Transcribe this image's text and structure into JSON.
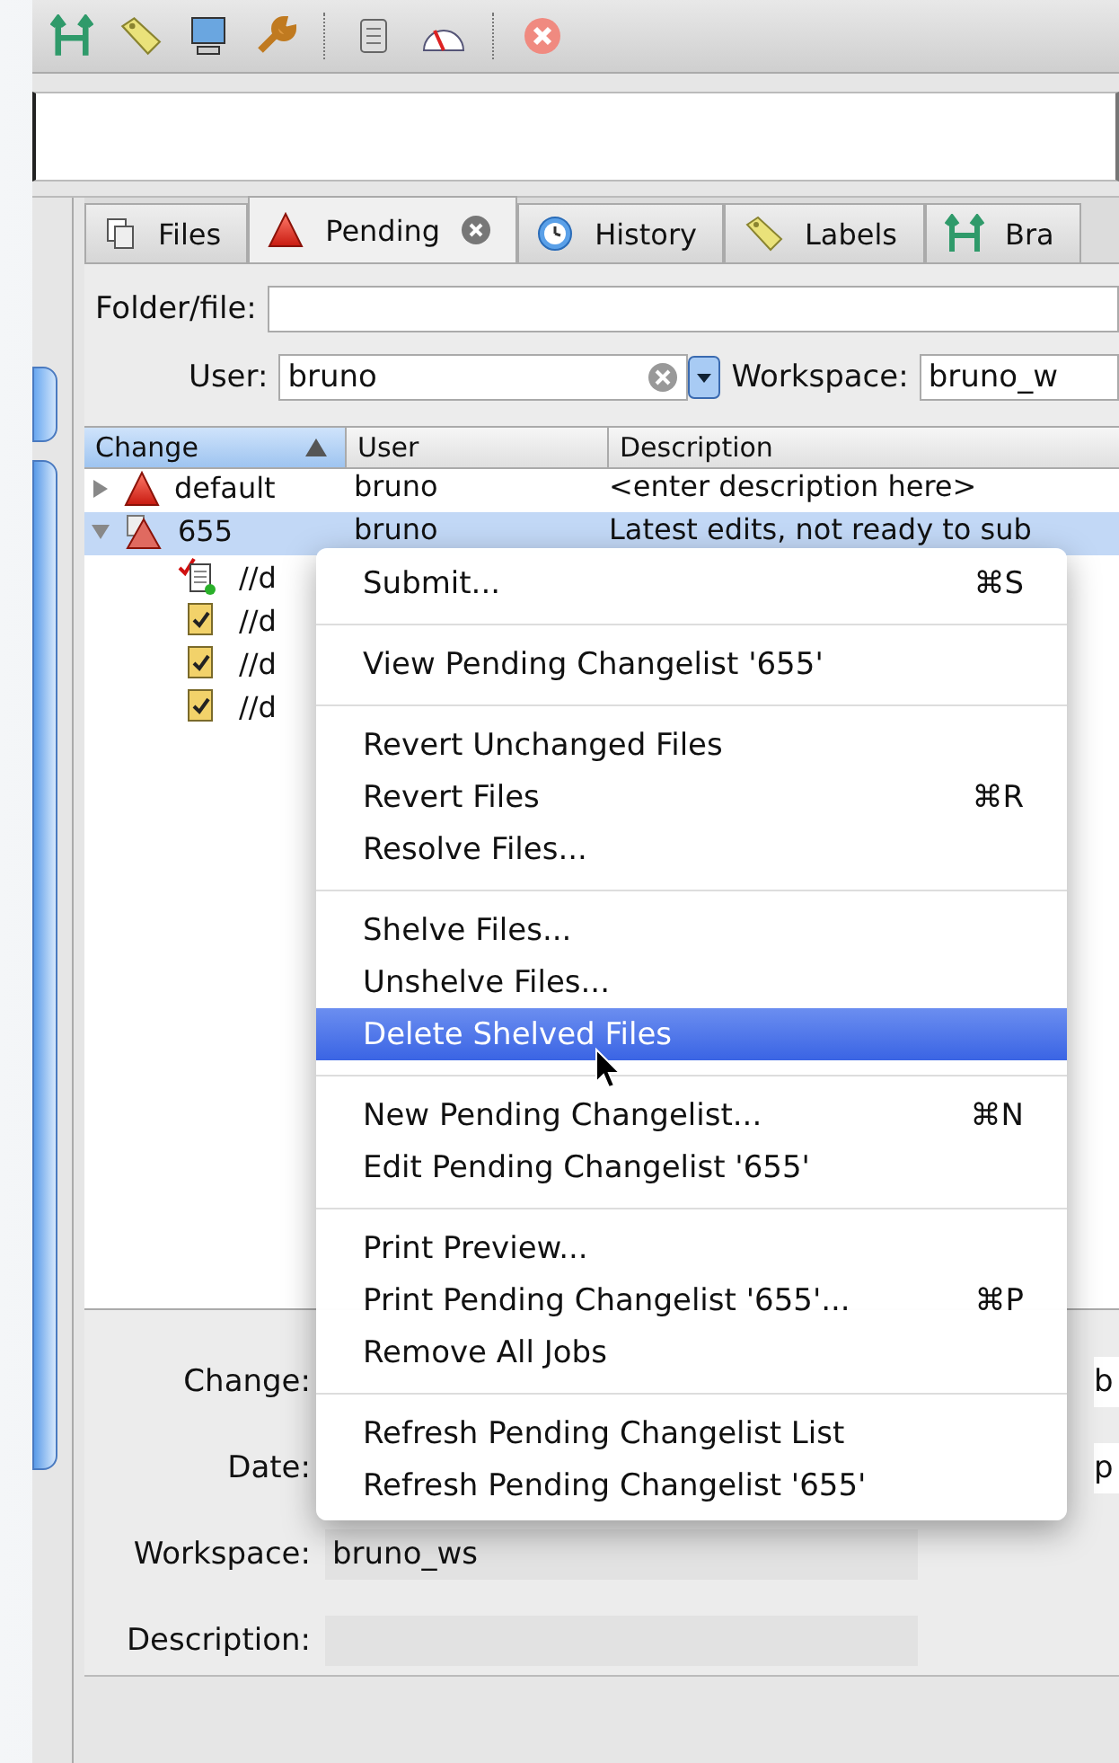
{
  "tabs": [
    {
      "kind": "files",
      "label": "Files",
      "selected": false,
      "closable": false
    },
    {
      "kind": "pending",
      "label": "Pending",
      "selected": true,
      "closable": true
    },
    {
      "kind": "history",
      "label": "History",
      "selected": false,
      "closable": false
    },
    {
      "kind": "labels",
      "label": "Labels",
      "selected": false,
      "closable": false
    },
    {
      "kind": "branches",
      "label": "Bra",
      "selected": false,
      "closable": false
    }
  ],
  "filter": {
    "folder_label": "Folder/file:",
    "user_label": "User:",
    "user_value": "bruno",
    "workspace_label": "Workspace:",
    "workspace_value": "bruno_w"
  },
  "table": {
    "columns": [
      {
        "label": "Change",
        "sorted": true
      },
      {
        "label": "User",
        "sorted": false
      },
      {
        "label": "Description",
        "sorted": false
      }
    ],
    "rows": [
      {
        "change": "default",
        "user": "bruno",
        "description": "<enter description here>",
        "expanded": false,
        "selected": false,
        "shelved": false
      },
      {
        "change": "655",
        "user": "bruno",
        "description": "Latest edits, not ready to sub",
        "expanded": true,
        "selected": true,
        "shelved": true,
        "children": [
          {
            "kind": "edit-add",
            "path": "//d"
          },
          {
            "kind": "edit",
            "path": "//d"
          },
          {
            "kind": "edit",
            "path": "//d"
          },
          {
            "kind": "edit",
            "path": "//d"
          }
        ]
      }
    ]
  },
  "details": {
    "fields": [
      {
        "label": "Change:",
        "right_value": "b"
      },
      {
        "label": "Date:",
        "right_value": "p"
      },
      {
        "label": "Workspace:",
        "value": "bruno_ws"
      },
      {
        "label": "Description:"
      }
    ]
  },
  "context_menu": {
    "groups": [
      [
        {
          "label": "Submit...",
          "shortcut": "⌘S",
          "selected": false
        }
      ],
      [
        {
          "label": "View Pending Changelist '655'",
          "selected": false
        }
      ],
      [
        {
          "label": "Revert Unchanged Files",
          "selected": false
        },
        {
          "label": "Revert Files",
          "shortcut": "⌘R",
          "selected": false
        },
        {
          "label": "Resolve Files...",
          "selected": false
        }
      ],
      [
        {
          "label": "Shelve Files...",
          "selected": false
        },
        {
          "label": "Unshelve Files...",
          "selected": false
        },
        {
          "label": "Delete Shelved Files",
          "selected": true
        }
      ],
      [
        {
          "label": "New Pending Changelist...",
          "shortcut": "⌘N",
          "selected": false
        },
        {
          "label": "Edit Pending Changelist '655'",
          "selected": false
        }
      ],
      [
        {
          "label": "Print Preview...",
          "selected": false
        },
        {
          "label": "Print Pending Changelist '655'...",
          "shortcut": "⌘P",
          "selected": false
        },
        {
          "label": "Remove All Jobs",
          "selected": false
        }
      ],
      [
        {
          "label": "Refresh Pending Changelist List",
          "selected": false
        },
        {
          "label": "Refresh Pending Changelist '655'",
          "selected": false
        }
      ]
    ]
  }
}
